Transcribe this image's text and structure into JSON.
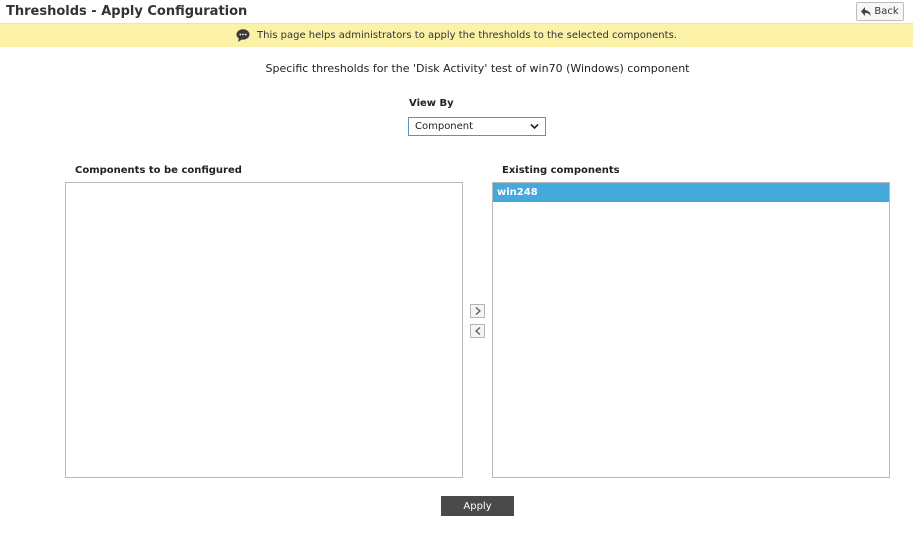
{
  "header": {
    "title": "Thresholds - Apply Configuration",
    "back_label": "Back"
  },
  "info": {
    "message": "This page helps administrators to apply the thresholds to the selected components.",
    "icon": "speech-bubble-icon"
  },
  "subtitle": "Specific thresholds for the 'Disk Activity' test of win70 (Windows) component",
  "view_by": {
    "label": "View By",
    "selected": "Component"
  },
  "left_list": {
    "label": "Components to be configured",
    "items": []
  },
  "right_list": {
    "label": "Existing components",
    "items": [
      "win248"
    ],
    "selected": "win248"
  },
  "apply_label": "Apply",
  "colors": {
    "info_bg": "#fbf2a8",
    "selected_bg": "#45a9db",
    "apply_bg": "#4a4a4a"
  }
}
